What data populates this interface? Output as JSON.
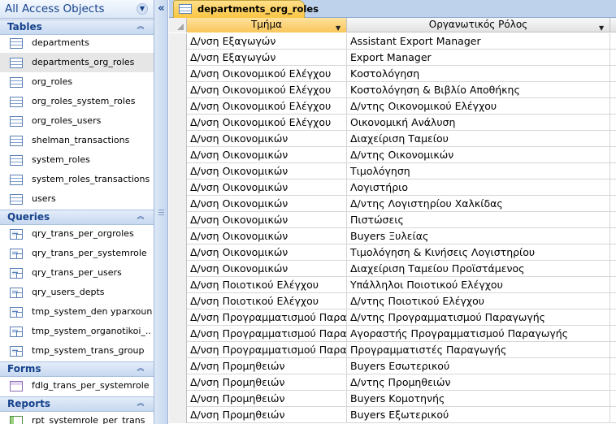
{
  "nav": {
    "title": "All Access Objects",
    "groups": {
      "tables": {
        "title": "Tables",
        "items": [
          "departments",
          "departments_org_roles",
          "org_roles",
          "org_roles_system_roles",
          "org_roles_users",
          "shelman_transactions",
          "system_roles",
          "system_roles_transactions",
          "users"
        ]
      },
      "queries": {
        "title": "Queries",
        "items": [
          "qry_trans_per_orgroles",
          "qry_trans_per_systemrole",
          "qry_trans_per_users",
          "qry_users_depts",
          "tmp_system_den yparxoun",
          "tmp_system_organotikoi_...",
          "tmp_system_trans_group"
        ]
      },
      "forms": {
        "title": "Forms",
        "items": [
          "fdlg_trans_per_systemrole"
        ]
      },
      "reports": {
        "title": "Reports",
        "items": [
          "rpt_systemrole_per_trans"
        ]
      }
    },
    "selected_item": "departments_org_roles"
  },
  "tab": {
    "label": "departments_org_roles"
  },
  "grid": {
    "columns": [
      "Τμήμα",
      "Οργανωτικός Ρόλος"
    ],
    "rows": [
      [
        "Δ/νση Εξαγωγών",
        "Assistant Export Manager"
      ],
      [
        "Δ/νση Εξαγωγών",
        "Export Manager"
      ],
      [
        "Δ/νση Οικονομικού Ελέγχου",
        "Κοστολόγηση"
      ],
      [
        "Δ/νση Οικονομικού Ελέγχου",
        "Κοστολόγηση & Βιβλίο Αποθήκης"
      ],
      [
        "Δ/νση Οικονομικού Ελέγχου",
        "Δ/ντης Οικονομικού Ελέγχου"
      ],
      [
        "Δ/νση Οικονομικού Ελέγχου",
        "Οικονομική Ανάλυση"
      ],
      [
        "Δ/νση Οικονομικών",
        "Διαχείριση Ταμείου"
      ],
      [
        "Δ/νση Οικονομικών",
        "Δ/ντης Οικονομικών"
      ],
      [
        "Δ/νση Οικονομικών",
        "Τιμολόγηση"
      ],
      [
        "Δ/νση Οικονομικών",
        "Λογιστήριο"
      ],
      [
        "Δ/νση Οικονομικών",
        "Δ/ντης Λογιστηρίου Χαλκίδας"
      ],
      [
        "Δ/νση Οικονομικών",
        "Πιστώσεις"
      ],
      [
        "Δ/νση Οικονομικών",
        "Buyers Ξυλείας"
      ],
      [
        "Δ/νση Οικονομικών",
        "Τιμολόγηση & Κινήσεις Λογιστηρίου"
      ],
      [
        "Δ/νση Οικονομικών",
        "Διαχείριση Ταμείου Προϊστάμενος"
      ],
      [
        "Δ/νση Ποιοτικού Ελέγχου",
        "Υπάλληλοι Ποιοτικού Ελέγχου"
      ],
      [
        "Δ/νση Ποιοτικού Ελέγχου",
        "Δ/ντης Ποιοτικού Ελέγχου"
      ],
      [
        "Δ/νση Προγραμματισμού Παρα",
        "Δ/ντης Προγραμματισμού Παραγωγής"
      ],
      [
        "Δ/νση Προγραμματισμού Παρα",
        "Αγοραστής Προγραμματισμού Παραγωγής"
      ],
      [
        "Δ/νση Προγραμματισμού Παρα",
        "Προγραμματιστές Παραγωγής"
      ],
      [
        "Δ/νση Προμηθειών",
        "Buyers Εσωτερικού"
      ],
      [
        "Δ/νση Προμηθειών",
        "Δ/ντης Προμηθειών"
      ],
      [
        "Δ/νση Προμηθειών",
        "Buyers Κομοτηνής"
      ],
      [
        "Δ/νση Προμηθειών",
        "Buyers Εξωτερικού"
      ]
    ]
  },
  "icons": {
    "nav_dropdown": "chevron-down-icon",
    "collapse_pane": "double-chevron-left-icon",
    "group_collapse": "double-chevron-up-icon",
    "table": "table-icon",
    "query": "query-icon",
    "form": "form-icon",
    "report": "report-icon"
  },
  "colors": {
    "nav_title": "#15428b",
    "active_tab": "#f9c543",
    "sorted_header": "#f9c65a"
  }
}
